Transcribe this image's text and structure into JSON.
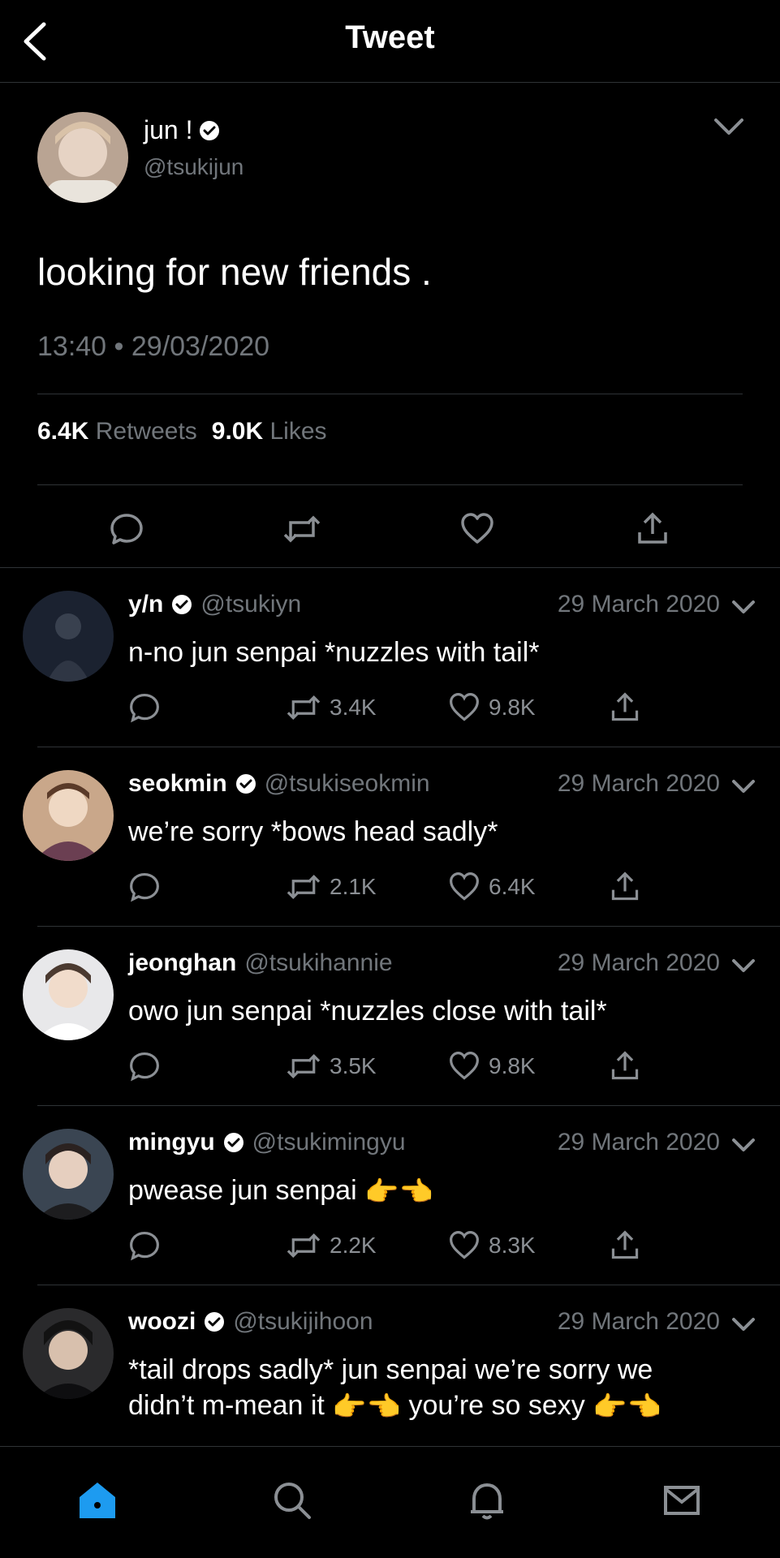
{
  "header": {
    "title": "Tweet"
  },
  "main_tweet": {
    "name": "jun !",
    "handle": "@tsukijun",
    "text": "looking for new friends .",
    "timestamp": "13:40 • 29/03/2020",
    "retweets_count": "6.4K",
    "retweets_label": "Retweets",
    "likes_count": "9.0K",
    "likes_label": "Likes"
  },
  "replies": [
    {
      "name": "y/n",
      "verified": true,
      "handle": "@tsukiyn",
      "date": "29 March 2020",
      "text": "n-no jun senpai *nuzzles with tail*",
      "retweets": "3.4K",
      "likes": "9.8K"
    },
    {
      "name": "seokmin",
      "verified": true,
      "handle": "@tsukiseokmin",
      "date": "29 March 2020",
      "text": "we’re sorry *bows head sadly*",
      "retweets": "2.1K",
      "likes": "6.4K"
    },
    {
      "name": "jeonghan",
      "verified": false,
      "handle": "@tsukihannie",
      "date": "29 March 2020",
      "text": "owo jun senpai *nuzzles close with tail*",
      "retweets": "3.5K",
      "likes": "9.8K"
    },
    {
      "name": "mingyu",
      "verified": true,
      "handle": "@tsukimingyu",
      "date": "29 March 2020",
      "text": "pwease jun senpai",
      "text_emoji": "👉👈",
      "retweets": "2.2K",
      "likes": "8.3K"
    },
    {
      "name": "woozi",
      "verified": true,
      "handle": "@tsukijihoon",
      "date": "29 March 2020",
      "text_line1": "*tail drops sadly* jun senpai we’re sorry we",
      "text_line2a": "didn’t m-mean it",
      "text_line2b": "you’re so sexy",
      "text_emoji": "👉👈"
    }
  ],
  "tabbar": {
    "items": [
      "home-icon",
      "search-icon",
      "notifications-icon",
      "messages-icon"
    ],
    "active_color": "#1d9bf0"
  }
}
